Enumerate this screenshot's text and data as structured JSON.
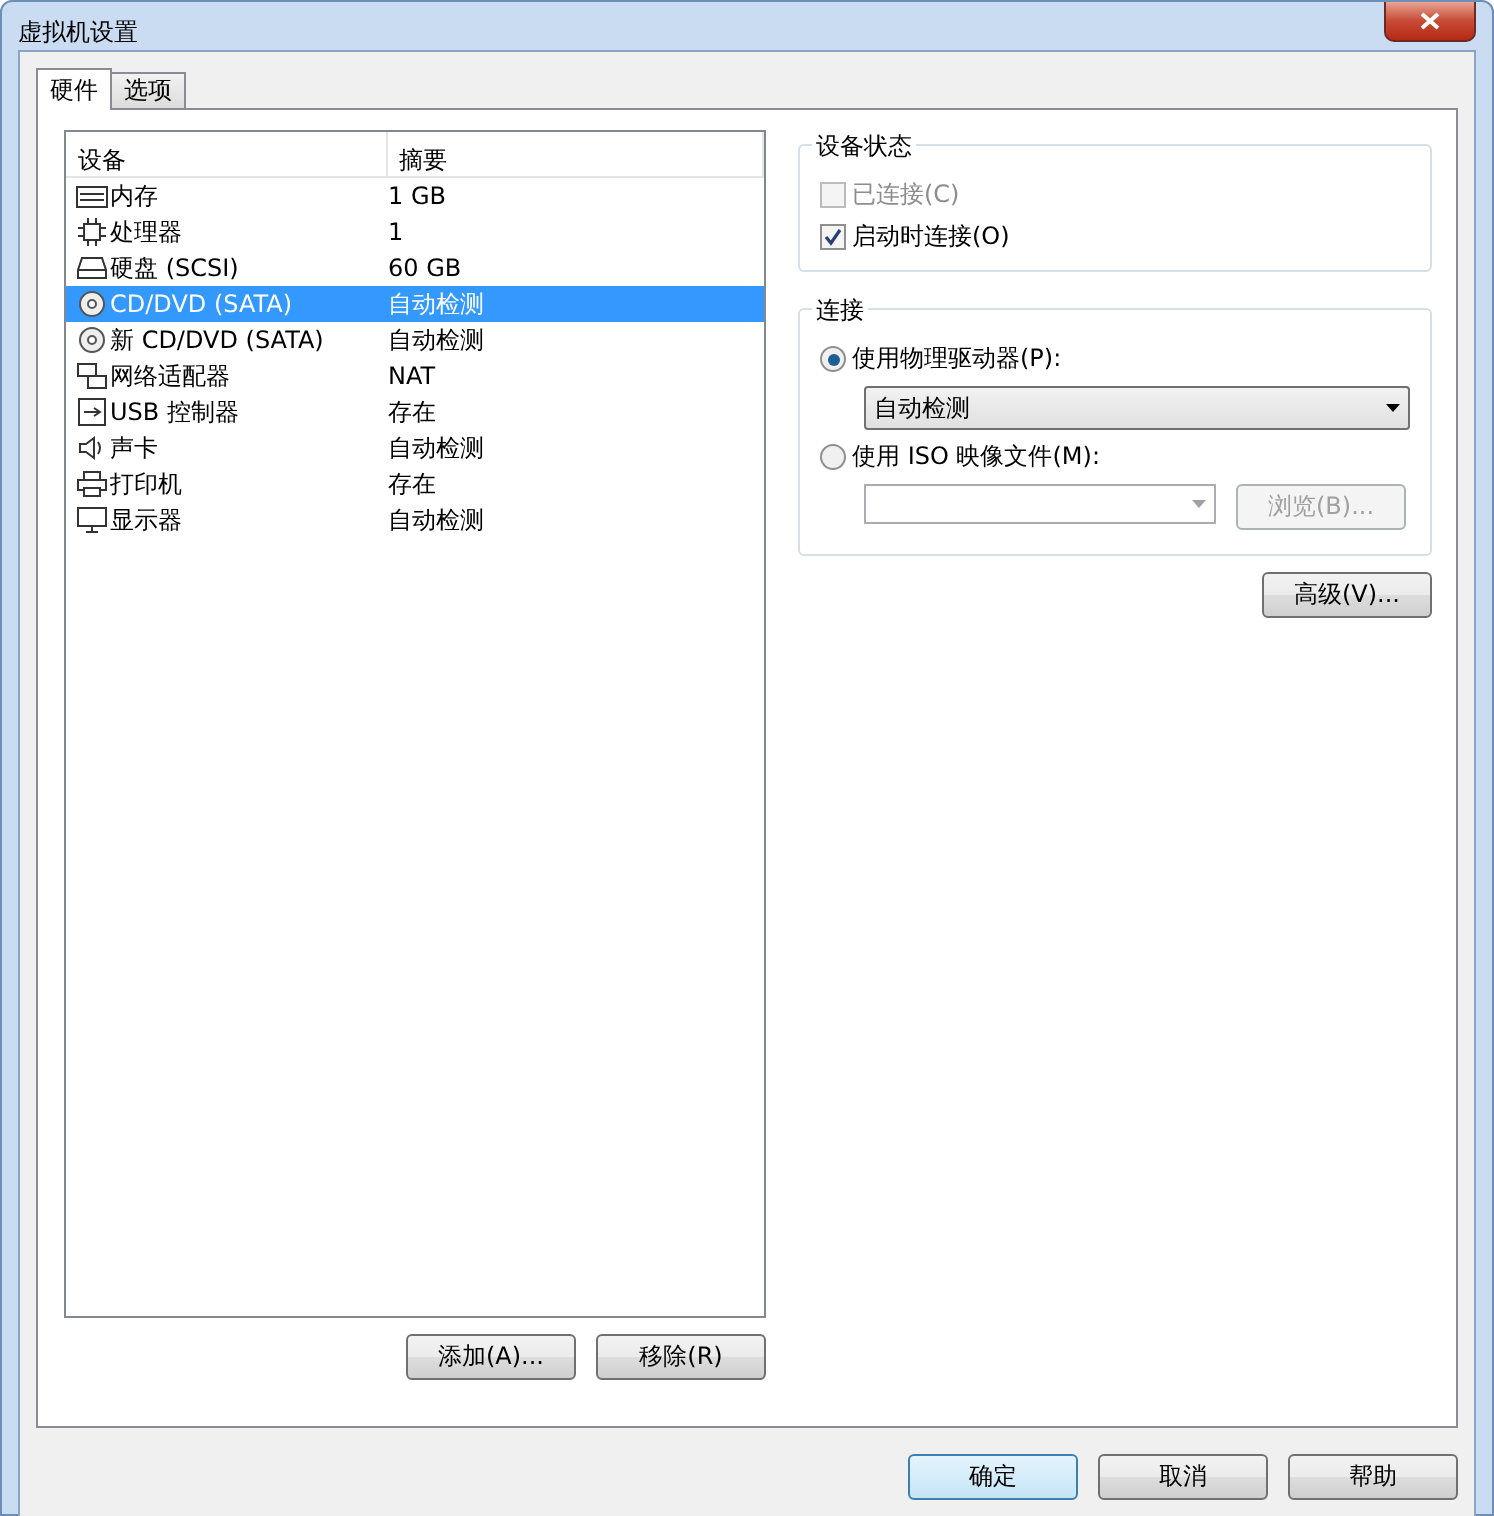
{
  "window": {
    "title": "虚拟机设置"
  },
  "tabs": [
    {
      "label": "硬件",
      "selected": true
    },
    {
      "label": "选项",
      "selected": false
    }
  ],
  "device_list": {
    "columns": [
      "设备",
      "摘要"
    ],
    "rows": [
      {
        "device": "内存",
        "summary": "1 GB",
        "selected": false
      },
      {
        "device": "处理器",
        "summary": "1",
        "selected": false
      },
      {
        "device": "硬盘 (SCSI)",
        "summary": "60 GB",
        "selected": false
      },
      {
        "device": "CD/DVD (SATA)",
        "summary": "自动检测",
        "selected": true
      },
      {
        "device": "新 CD/DVD (SATA)",
        "summary": "自动检测",
        "selected": false
      },
      {
        "device": "网络适配器",
        "summary": "NAT",
        "selected": false
      },
      {
        "device": "USB 控制器",
        "summary": "存在",
        "selected": false
      },
      {
        "device": "声卡",
        "summary": "自动检测",
        "selected": false
      },
      {
        "device": "打印机",
        "summary": "存在",
        "selected": false
      },
      {
        "device": "显示器",
        "summary": "自动检测",
        "selected": false
      }
    ]
  },
  "list_buttons": [
    "添加(A)...",
    "移除(R)"
  ],
  "device_status": {
    "title": "设备状态",
    "options": [
      {
        "label": "已连接(C)",
        "checked": false,
        "disabled": true
      },
      {
        "label": "启动时连接(O)",
        "checked": true,
        "disabled": false
      }
    ]
  },
  "connection": {
    "title": "连接",
    "physical": {
      "label": "使用物理驱动器(P):",
      "selected": true,
      "drive": "自动检测"
    },
    "iso": {
      "label": "使用 ISO 映像文件(M):",
      "selected": false,
      "browse": {
        "label": "浏览(B)...",
        "disabled": true
      }
    }
  },
  "advanced_button": "高级(V)...",
  "footer_buttons": [
    {
      "label": "确定",
      "default": true
    },
    {
      "label": "取消",
      "default": false
    },
    {
      "label": "帮助",
      "default": false
    }
  ]
}
